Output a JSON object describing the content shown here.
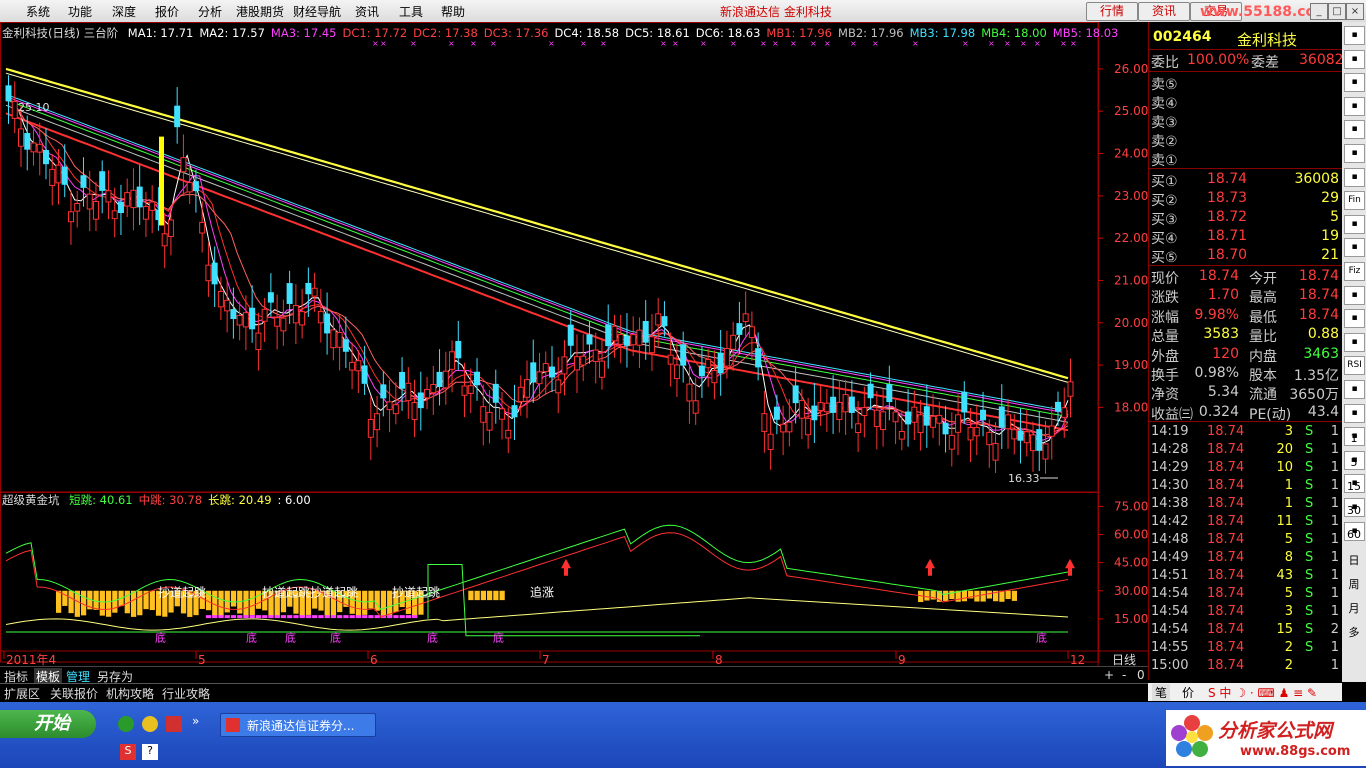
{
  "menu": {
    "items": [
      "系统",
      "功能",
      "深度",
      "报价",
      "分析",
      "港股期货",
      "财经导航",
      "资讯",
      "工具",
      "帮助"
    ],
    "app_title": "新浪通达信  金利科技",
    "buttons": [
      "行情",
      "资讯",
      "交易"
    ],
    "watermark": "www.55188.com"
  },
  "chart": {
    "main_legend": {
      "title": "金利科技(日线) 三台阶",
      "items": [
        {
          "text": "MA1: 17.71",
          "color": "#ffffff"
        },
        {
          "text": "MA2: 17.57",
          "color": "#ffffff"
        },
        {
          "text": "MA3: 17.45",
          "color": "#ff40ff"
        },
        {
          "text": "DC1: 17.72",
          "color": "#ff4040"
        },
        {
          "text": "DC2: 17.38",
          "color": "#ff4040"
        },
        {
          "text": "DC3: 17.36",
          "color": "#ff4040"
        },
        {
          "text": "DC4: 18.58",
          "color": "#ffffff"
        },
        {
          "text": "DC5: 18.61",
          "color": "#ffffff"
        },
        {
          "text": "DC6: 18.63",
          "color": "#ffffff"
        },
        {
          "text": "MB1: 17.96",
          "color": "#ff4040"
        },
        {
          "text": "MB2: 17.96",
          "color": "#c0c0c0"
        },
        {
          "text": "MB3: 17.98",
          "color": "#40e0ff"
        },
        {
          "text": "MB4: 18.00",
          "color": "#40ff40"
        },
        {
          "text": "MB5: 18.03",
          "color": "#ff40ff"
        }
      ]
    },
    "price_axis": [
      "26.00",
      "25.00",
      "24.00",
      "23.00",
      "22.00",
      "21.00",
      "20.00",
      "19.00",
      "18.00"
    ],
    "high_label": "25.10",
    "low_label": "16.33",
    "sub_legend": {
      "title": "超级黄金坑",
      "items": [
        {
          "text": "短跳: 40.61",
          "color": "#40ff40"
        },
        {
          "text": "中跳: 30.78",
          "color": "#ff4040"
        },
        {
          "text": "长跳: 20.49",
          "color": "#ffff40"
        },
        {
          "text": ": 6.00",
          "color": "#ffffff"
        }
      ]
    },
    "sub_axis": [
      "75.00",
      "60.00",
      "45.00",
      "30.00",
      "15.00"
    ],
    "annotations": [
      "抄道起跳",
      "抄道起跳抄道起跳",
      "抄道起跳",
      "追涨"
    ],
    "bottom_marks": [
      "底",
      "底",
      "底",
      "底",
      "底",
      "底",
      "底"
    ],
    "dates": [
      "2011年4",
      "5",
      "6",
      "7",
      "8",
      "9",
      "12"
    ],
    "period": "日线"
  },
  "quote": {
    "code": "002464",
    "name": "金利科技",
    "weibi_label": "委比",
    "weibi_value": "100.00%",
    "weicha_label": "委差",
    "weicha_value": "36082",
    "sells": [
      "卖⑤",
      "卖④",
      "卖③",
      "卖②",
      "卖①"
    ],
    "buys": [
      {
        "label": "买①",
        "price": "18.74",
        "vol": "36008"
      },
      {
        "label": "买②",
        "price": "18.73",
        "vol": "29"
      },
      {
        "label": "买③",
        "price": "18.72",
        "vol": "5"
      },
      {
        "label": "买④",
        "price": "18.71",
        "vol": "19"
      },
      {
        "label": "买⑤",
        "price": "18.70",
        "vol": "21"
      }
    ],
    "stats": [
      {
        "l1": "现价",
        "v1": "18.74",
        "l2": "今开",
        "v2": "18.74",
        "c1": "red",
        "c2": "red"
      },
      {
        "l1": "涨跌",
        "v1": "1.70",
        "l2": "最高",
        "v2": "18.74",
        "c1": "red",
        "c2": "red"
      },
      {
        "l1": "涨幅",
        "v1": "9.98%",
        "l2": "最低",
        "v2": "18.74",
        "c1": "red",
        "c2": "red"
      },
      {
        "l1": "总量",
        "v1": "3583",
        "l2": "量比",
        "v2": "0.88",
        "c1": "yel",
        "c2": "yel"
      },
      {
        "l1": "外盘",
        "v1": "120",
        "l2": "内盘",
        "v2": "3463",
        "c1": "red",
        "c2": "grn"
      },
      {
        "l1": "换手",
        "v1": "0.98%",
        "l2": "股本",
        "v2": "1.35亿",
        "c1": "lbl",
        "c2": "lbl"
      },
      {
        "l1": "净资",
        "v1": "5.34",
        "l2": "流通",
        "v2": "3650万",
        "c1": "lbl",
        "c2": "lbl"
      },
      {
        "l1": "收益㈢",
        "v1": "0.324",
        "l2": "PE(动)",
        "v2": "43.4",
        "c1": "lbl",
        "c2": "lbl"
      }
    ],
    "ticks": [
      {
        "t": "14:19",
        "p": "18.74",
        "v": "3",
        "d": "S",
        "n": "1"
      },
      {
        "t": "14:28",
        "p": "18.74",
        "v": "20",
        "d": "S",
        "n": "1"
      },
      {
        "t": "14:29",
        "p": "18.74",
        "v": "10",
        "d": "S",
        "n": "1"
      },
      {
        "t": "14:30",
        "p": "18.74",
        "v": "1",
        "d": "S",
        "n": "1"
      },
      {
        "t": "14:38",
        "p": "18.74",
        "v": "1",
        "d": "S",
        "n": "1"
      },
      {
        "t": "14:42",
        "p": "18.74",
        "v": "11",
        "d": "S",
        "n": "1"
      },
      {
        "t": "14:48",
        "p": "18.74",
        "v": "5",
        "d": "S",
        "n": "1"
      },
      {
        "t": "14:49",
        "p": "18.74",
        "v": "8",
        "d": "S",
        "n": "1"
      },
      {
        "t": "14:51",
        "p": "18.74",
        "v": "43",
        "d": "S",
        "n": "1"
      },
      {
        "t": "14:54",
        "p": "18.74",
        "v": "5",
        "d": "S",
        "n": "1"
      },
      {
        "t": "14:54",
        "p": "18.74",
        "v": "3",
        "d": "S",
        "n": "1"
      },
      {
        "t": "14:54",
        "p": "18.74",
        "v": "15",
        "d": "S",
        "n": "2"
      },
      {
        "t": "14:55",
        "p": "18.74",
        "v": "2",
        "d": "S",
        "n": "1"
      },
      {
        "t": "15:00",
        "p": "18.74",
        "v": "2",
        "d": "",
        "n": "1"
      }
    ]
  },
  "tools": [
    "Fin",
    "Fiz",
    "RSI"
  ],
  "tool_numbers": [
    "1",
    "5",
    "15",
    "30",
    "60",
    "日",
    "周",
    "月",
    "多"
  ],
  "tabs": [
    "指标",
    "模板",
    "管理",
    "另存为"
  ],
  "tab_controls": [
    "+",
    "-",
    "0"
  ],
  "ext_tabs": [
    "扩展区",
    "关联报价",
    "机构攻略",
    "行业攻略"
  ],
  "ext_right": [
    "笔",
    "价"
  ],
  "taskbar": {
    "start": "开始",
    "task": "新浪通达信证券分...",
    "brand": "分析家公式网",
    "brand_url": "www.88gs.com"
  }
}
